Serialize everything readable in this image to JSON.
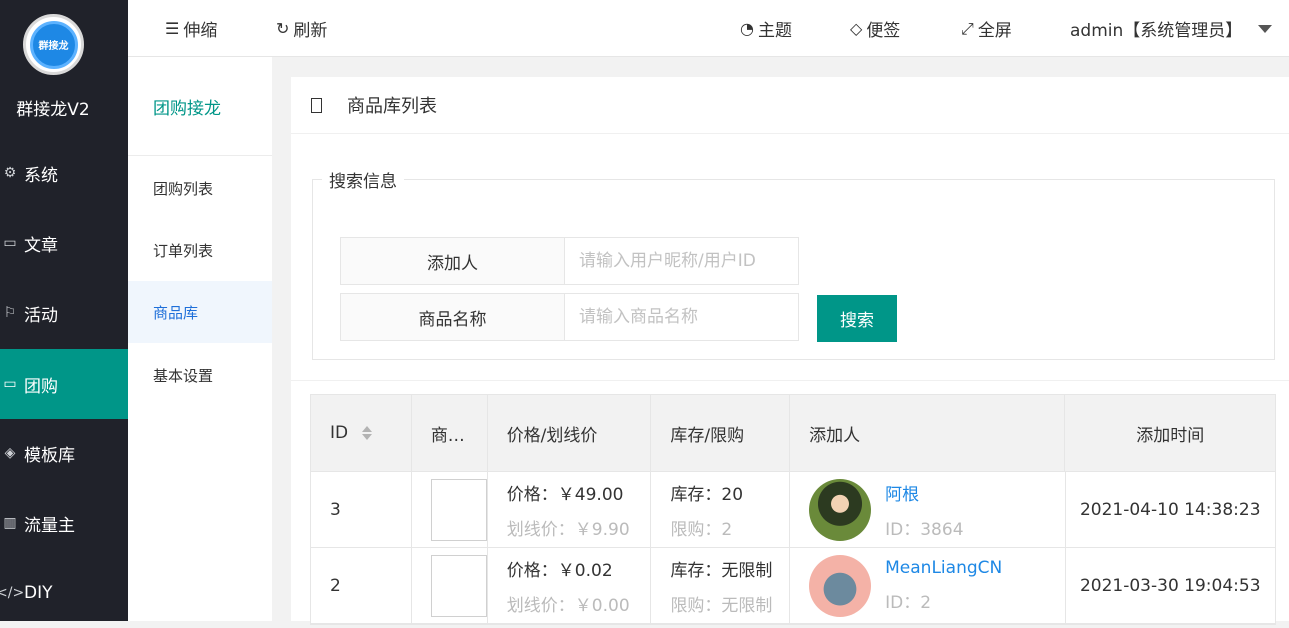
{
  "nav": {
    "logo_text": "群接龙",
    "brand": "群接龙V2",
    "items": [
      {
        "label": "系统",
        "icon": "gear-icon"
      },
      {
        "label": "文章",
        "icon": "book-icon"
      },
      {
        "label": "活动",
        "icon": "flag-icon"
      },
      {
        "label": "团购",
        "icon": "cart-icon",
        "active": true
      },
      {
        "label": "模板库",
        "icon": "layers-icon"
      },
      {
        "label": "流量主",
        "icon": "chart-icon"
      },
      {
        "label": "DIY",
        "icon": "code-icon"
      }
    ]
  },
  "subnav": {
    "title": "团购接龙",
    "items": [
      {
        "label": "团购列表"
      },
      {
        "label": "订单列表"
      },
      {
        "label": "商品库",
        "active": true
      },
      {
        "label": "基本设置"
      }
    ]
  },
  "header": {
    "collapse": "伸缩",
    "refresh": "刷新",
    "theme": "主题",
    "note": "便签",
    "fullscreen": "全屏",
    "user": "admin【系统管理员】"
  },
  "page": {
    "title": "商品库列表",
    "search_legend": "搜索信息",
    "adder_label": "添加人",
    "adder_placeholder": "请输入用户昵称/用户ID",
    "name_label": "商品名称",
    "name_placeholder": "请输入商品名称",
    "search_button": "搜索"
  },
  "table": {
    "headers": {
      "id": "ID",
      "img": "商…",
      "price": "价格/划线价",
      "stock": "库存/限购",
      "adder": "添加人",
      "time": "添加时间"
    },
    "rows": [
      {
        "id": "3",
        "price": "价格：￥49.00",
        "line_price": "划线价：￥9.90",
        "stock": "库存：20",
        "limit": "限购：2",
        "user": "阿根",
        "uid": "ID：3864",
        "time": "2021-04-10 14:38:23"
      },
      {
        "id": "2",
        "price": "价格：￥0.02",
        "line_price": "划线价：￥0.00",
        "stock": "库存：无限制",
        "limit": "限购：无限制",
        "user": "MeanLiangCN",
        "uid": "ID：2",
        "time": "2021-03-30 19:04:53"
      }
    ]
  },
  "colors": {
    "accent": "#009688",
    "link": "#1e88e5",
    "nav_bg": "#20222a"
  }
}
